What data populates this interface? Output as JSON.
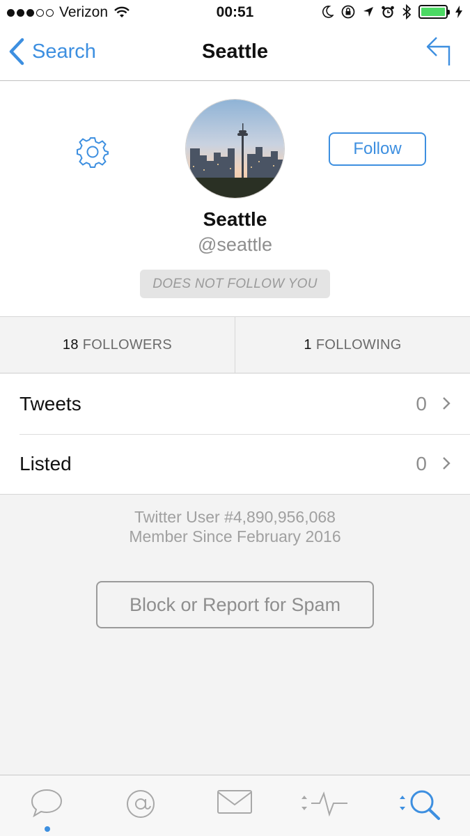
{
  "status_bar": {
    "carrier": "Verizon",
    "time": "00:51"
  },
  "nav": {
    "back_label": "Search",
    "title": "Seattle"
  },
  "profile": {
    "name": "Seattle",
    "handle": "@seattle",
    "follow_button": "Follow",
    "follow_status": "DOES NOT FOLLOW YOU"
  },
  "counts": {
    "followers_count": "18",
    "followers_label": "FOLLOWERS",
    "following_count": "1",
    "following_label": "FOLLOWING"
  },
  "rows": [
    {
      "label": "Tweets",
      "value": "0"
    },
    {
      "label": "Listed",
      "value": "0"
    }
  ],
  "info": {
    "user_number": "Twitter User #4,890,956,068",
    "member_since": "Member Since February 2016"
  },
  "block_button": "Block or Report for Spam",
  "tabs": [
    "timeline-tab",
    "mentions-tab",
    "messages-tab",
    "activity-tab",
    "search-tab"
  ],
  "colors": {
    "accent": "#3d8fe0",
    "battery": "#4cd964",
    "background": "#f3f3f3"
  }
}
